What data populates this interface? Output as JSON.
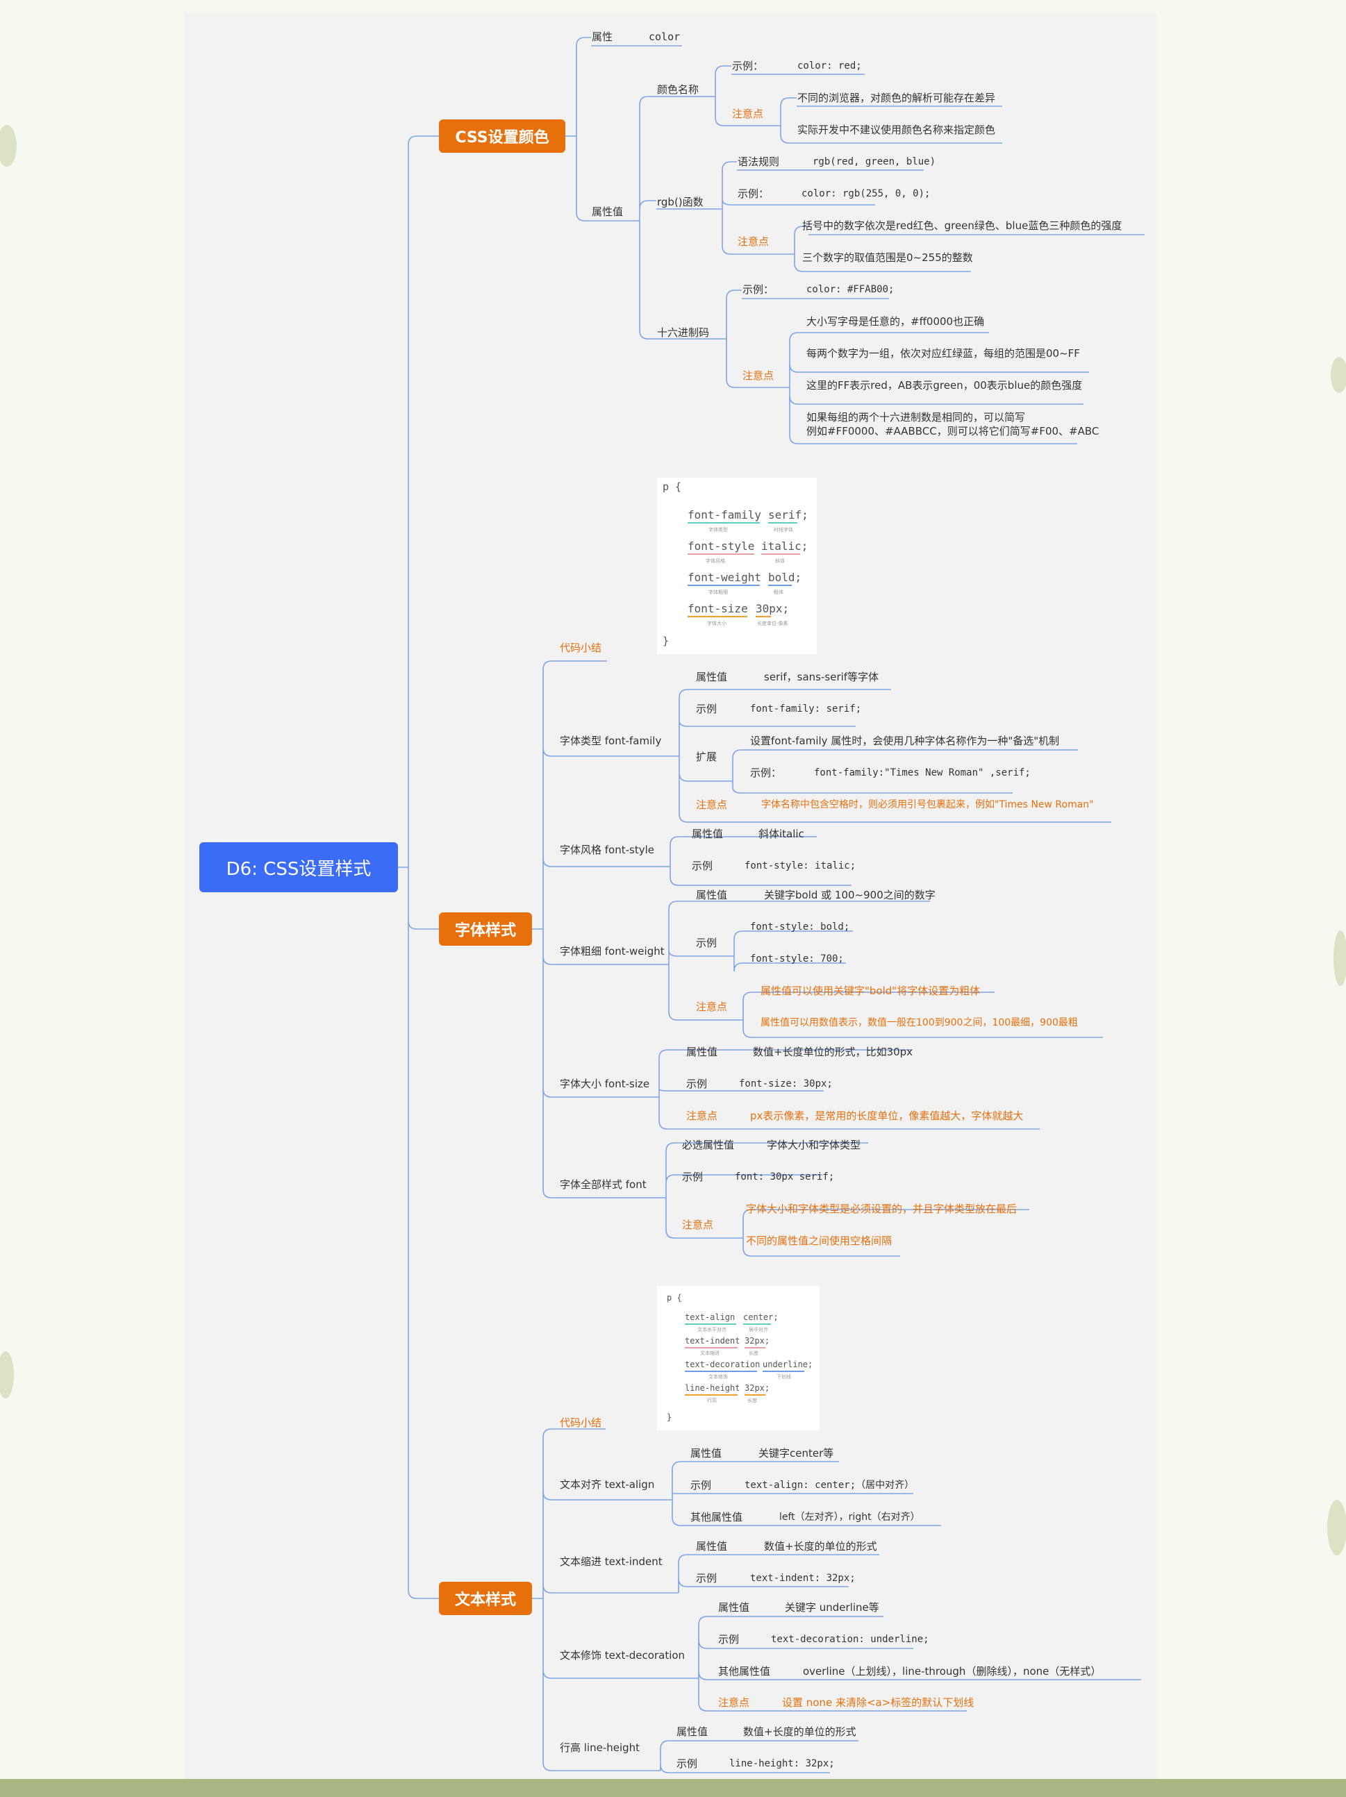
{
  "root": "D6: CSS设置样式",
  "branches": {
    "color": "CSS设置颜色",
    "font": "字体样式",
    "text": "文本样式"
  },
  "color": {
    "attr": "属性",
    "attr_val": "color",
    "values": "属性值",
    "name": {
      "label": "颜色名称",
      "ex": "示例：",
      "ex_val": "color: red;",
      "note": "注意点",
      "n1": "不同的浏览器，对颜色的解析可能存在差异",
      "n2": "实际开发中不建议使用颜色名称来指定颜色"
    },
    "rgb": {
      "label": "rgb()函数",
      "rule": "语法规则",
      "rule_val": "rgb(red, green, blue)",
      "ex": "示例：",
      "ex_val": "color: rgb(255, 0, 0);",
      "note": "注意点",
      "n1": "括号中的数字依次是red红色、green绿色、blue蓝色三种颜色的强度",
      "n2": "三个数字的取值范围是0~255的整数"
    },
    "hex": {
      "label": "十六进制码",
      "ex": "示例：",
      "ex_val": "color: #FFAB00;",
      "note": "注意点",
      "n1": "大小写字母是任意的，#ff0000也正确",
      "n2": "每两个数字为一组，依次对应红绿蓝，每组的范围是00~FF",
      "n3": "这里的FF表示red，AB表示green，00表示blue的颜色强度",
      "n4a": "如果每组的两个十六进制数是相同的，可以简写",
      "n4b": "例如#FF0000、#AABBCC，则可以将它们简写#F00、#ABC"
    }
  },
  "font": {
    "code_img": {
      "open": "p {",
      "close": "}",
      "lines": [
        {
          "prop": "font-family",
          "val": "serif;",
          "c1": "字体类型",
          "c2": "衬线字体"
        },
        {
          "prop": "font-style",
          "val": "italic;",
          "c1": "字体风格",
          "c2": "斜体"
        },
        {
          "prop": "font-weight",
          "val": "bold;",
          "c1": "字体粗细",
          "c2": "粗体"
        },
        {
          "prop": "font-size",
          "val": "30px;",
          "c1": "字体大小",
          "c2": "长度单位-像素"
        }
      ]
    },
    "summary": "代码小结",
    "family": {
      "label": "字体类型 font-family",
      "val": "属性值",
      "val_text": "serif，sans-serif等字体",
      "ex": "示例",
      "ex_val": "font-family: serif;",
      "ext": "扩展",
      "ext_text": "设置font-family 属性时，会使用几种字体名称作为一种\"备选\"机制",
      "ext_ex": "示例：",
      "ext_ex_val": "font-family:\"Times New Roman\" ,serif;",
      "note": "注意点",
      "note_text": "字体名称中包含空格时，则必须用引号包裹起来，例如\"Times New Roman\""
    },
    "style": {
      "label": "字体风格 font-style",
      "val": "属性值",
      "val_text": "斜体italic",
      "ex": "示例",
      "ex_val": "font-style: italic;"
    },
    "weight": {
      "label": "字体粗细 font-weight",
      "val": "属性值",
      "val_text": "关键字bold 或 100~900之间的数字",
      "ex": "示例",
      "ex1": "font-style: bold;",
      "ex2": "font-style: 700;",
      "note": "注意点",
      "n1": "属性值可以使用关键字\"bold\"将字体设置为粗体",
      "n2": "属性值可以用数值表示，数值一般在100到900之间，100最细，900最粗"
    },
    "size": {
      "label": "字体大小 font-size",
      "val": "属性值",
      "val_text": "数值+长度单位的形式，比如30px",
      "ex": "示例",
      "ex_val": "font-size: 30px;",
      "note": "注意点",
      "note_text": "px表示像素，是常用的长度单位，像素值越大，字体就越大"
    },
    "all": {
      "label": "字体全部样式 font",
      "req": "必选属性值",
      "req_text": "字体大小和字体类型",
      "ex": "示例",
      "ex_val": "font: 30px serif;",
      "note": "注意点",
      "n1": "字体大小和字体类型是必须设置的，并且字体类型放在最后",
      "n2": "不同的属性值之间使用空格间隔"
    }
  },
  "text": {
    "code_img": {
      "open": "p {",
      "close": "}",
      "lines": [
        {
          "prop": "text-align",
          "val": "center;",
          "c1": "文本水平对齐",
          "c2": "居中对齐"
        },
        {
          "prop": "text-indent",
          "val": "32px;",
          "c1": "文本缩进",
          "c2": "长度"
        },
        {
          "prop": "text-decoration",
          "val": "underline;",
          "c1": "文本修饰",
          "c2": "下划线"
        },
        {
          "prop": "line-height",
          "val": "32px;",
          "c1": "行高",
          "c2": "长度"
        }
      ]
    },
    "summary": "代码小结",
    "align": {
      "label": "文本对齐 text-align",
      "val": "属性值",
      "val_text": "关键字center等",
      "ex": "示例",
      "ex_val": "text-align: center;（居中对齐）",
      "other": "其他属性值",
      "other_text": "left（左对齐），right（右对齐）"
    },
    "indent": {
      "label": "文本缩进 text-indent",
      "val": "属性值",
      "val_text": "数值+长度的单位的形式",
      "ex": "示例",
      "ex_val": "text-indent: 32px;"
    },
    "decoration": {
      "label": "文本修饰 text-decoration",
      "val": "属性值",
      "val_text": "关键字 underline等",
      "ex": "示例",
      "ex_val": "text-decoration: underline;",
      "other": "其他属性值",
      "other_text": "overline（上划线），line-through（删除线），none（无样式）",
      "note": "注意点",
      "note_text": "设置 none 来清除<a>标签的默认下划线"
    },
    "lineheight": {
      "label": "行高 line-height",
      "val": "属性值",
      "val_text": "数值+长度的单位的形式",
      "ex": "示例",
      "ex_val": "line-height: 32px;"
    }
  },
  "colors": {
    "accent": "#e8700c",
    "root": "#3b6cf6",
    "line": "#7ea4e8",
    "panel": "#f2f2f2"
  }
}
